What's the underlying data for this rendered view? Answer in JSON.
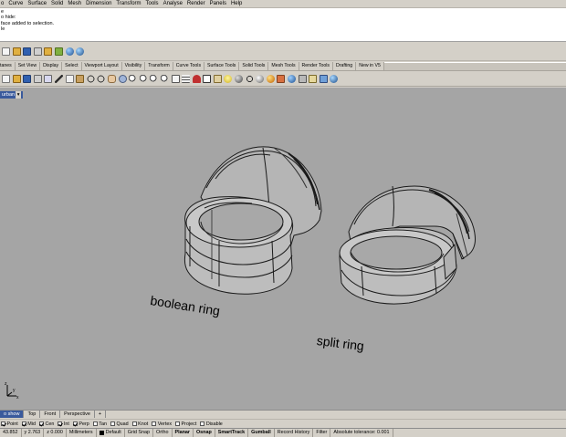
{
  "menu": [
    "o",
    "Curve",
    "Surface",
    "Solid",
    "Mesh",
    "Dimension",
    "Transform",
    "Tools",
    "Analyse",
    "Render",
    "Panels",
    "Help"
  ],
  "command_history": [
    "e",
    "o hide:",
    "face added to selection.",
    "le"
  ],
  "toolbar_tabs": [
    "tanes",
    "Set View",
    "Display",
    "Select",
    "Viewport Layout",
    "Visibility",
    "Transform",
    "Curve Tools",
    "Surface Tools",
    "Solid Tools",
    "Mesh Tools",
    "Render Tools",
    "Drafting",
    "New in V5"
  ],
  "viewport": {
    "title": "urban",
    "title_arrow": "▾",
    "background": "#a5a5a5",
    "labels": {
      "boolean": "boolean ring",
      "split": "split ring"
    }
  },
  "viewport_tabs": [
    {
      "label": "o show",
      "active": true
    },
    {
      "label": "Top",
      "active": false
    },
    {
      "label": "Front",
      "active": false
    },
    {
      "label": "Perspective",
      "active": false
    },
    {
      "label": "+",
      "active": false
    }
  ],
  "osnaps": [
    {
      "label": "Point",
      "checked": true
    },
    {
      "label": "Mid",
      "checked": true
    },
    {
      "label": "Cen",
      "checked": true
    },
    {
      "label": "Int",
      "checked": true
    },
    {
      "label": "Perp",
      "checked": true
    },
    {
      "label": "Tan",
      "checked": false
    },
    {
      "label": "Quad",
      "checked": false
    },
    {
      "label": "Knot",
      "checked": false
    },
    {
      "label": "Vertex",
      "checked": false
    },
    {
      "label": "Project",
      "checked": false
    },
    {
      "label": "Disable",
      "checked": false
    }
  ],
  "status": {
    "x": "43.852",
    "y": "y 2.763",
    "z": "z 0.000",
    "units": "Millimeters",
    "layer": "Default",
    "buttons": [
      {
        "label": "Grid Snap",
        "bold": false
      },
      {
        "label": "Ortho",
        "bold": false
      },
      {
        "label": "Planar",
        "bold": true
      },
      {
        "label": "Osnap",
        "bold": true
      },
      {
        "label": "SmartTrack",
        "bold": true
      },
      {
        "label": "Gumball",
        "bold": true
      },
      {
        "label": "Record History",
        "bold": false
      },
      {
        "label": "Filter",
        "bold": false
      }
    ],
    "tolerance": "Absolute tolerance: 0.001"
  },
  "colors": {
    "chrome": "#d4d0c8",
    "title_active": "#3a5a9c",
    "viewport_bg": "#a5a5a5"
  }
}
